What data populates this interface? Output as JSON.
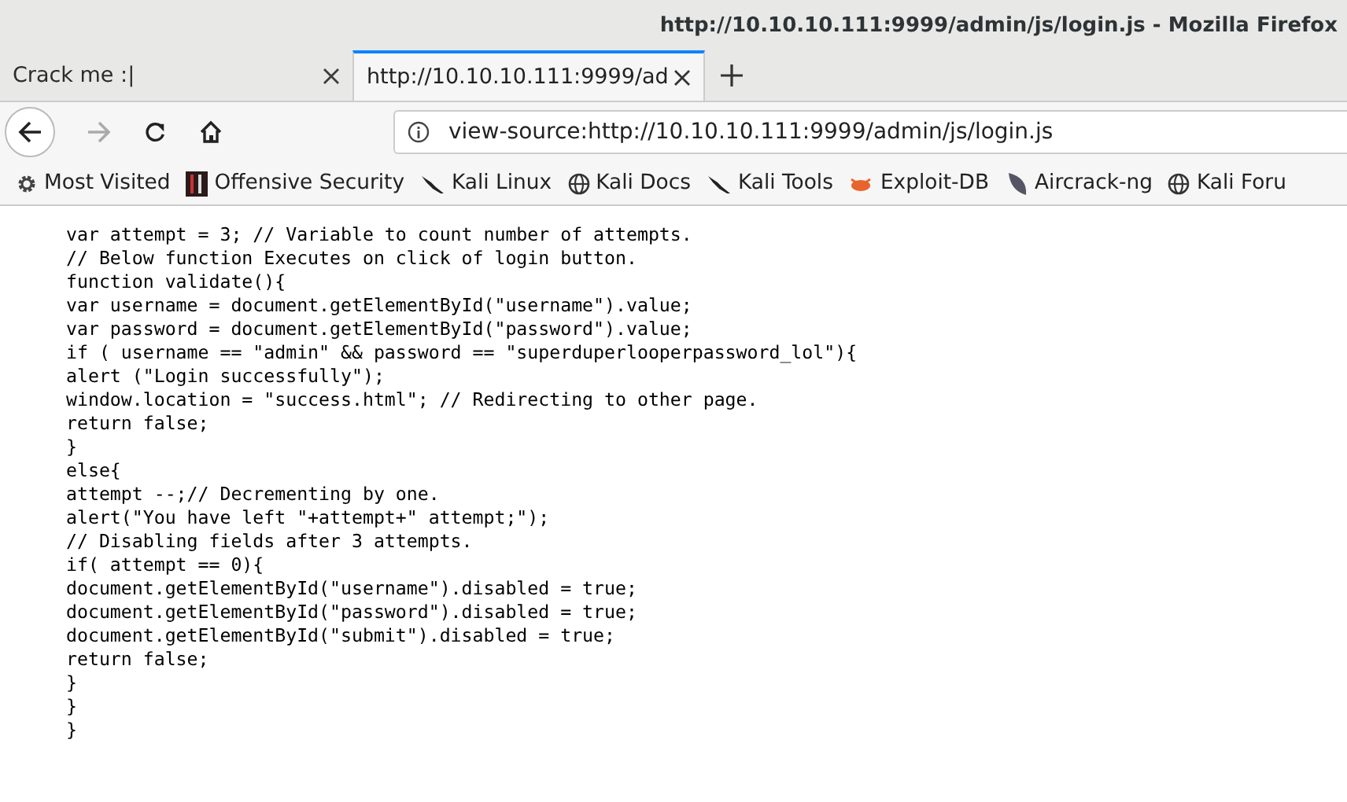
{
  "window": {
    "title": "http://10.10.10.111:9999/admin/js/login.js - Mozilla Firefox"
  },
  "tabs": [
    {
      "label": "Crack me :|",
      "selected": false
    },
    {
      "label": "http://10.10.10.111:9999/ad",
      "selected": true
    }
  ],
  "address_bar": {
    "value": "view-source:http://10.10.10.111:9999/admin/js/login.js"
  },
  "nav": {
    "forward_disabled": true
  },
  "bookmarks": [
    {
      "label": "Most Visited",
      "kind": "gear"
    },
    {
      "label": "Offensive Security",
      "kind": "offsec"
    },
    {
      "label": "Kali Linux",
      "kind": "kali"
    },
    {
      "label": "Kali Docs",
      "kind": "globe"
    },
    {
      "label": "Kali Tools",
      "kind": "kali"
    },
    {
      "label": "Exploit-DB",
      "kind": "bug"
    },
    {
      "label": "Aircrack-ng",
      "kind": "dish"
    },
    {
      "label": "Kali Foru",
      "kind": "globe"
    }
  ],
  "source_lines": [
    "var attempt = 3; // Variable to count number of attempts.",
    "// Below function Executes on click of login button.",
    "function validate(){",
    "var username = document.getElementById(\"username\").value;",
    "var password = document.getElementById(\"password\").value;",
    "if ( username == \"admin\" && password == \"superduperlooperpassword_lol\"){",
    "alert (\"Login successfully\");",
    "window.location = \"success.html\"; // Redirecting to other page.",
    "return false;",
    "}",
    "else{",
    "attempt --;// Decrementing by one.",
    "alert(\"You have left \"+attempt+\" attempt;\");",
    "// Disabling fields after 3 attempts.",
    "if( attempt == 0){",
    "document.getElementById(\"username\").disabled = true;",
    "document.getElementById(\"password\").disabled = true;",
    "document.getElementById(\"submit\").disabled = true;",
    "return false;",
    "}",
    "}",
    "}"
  ]
}
